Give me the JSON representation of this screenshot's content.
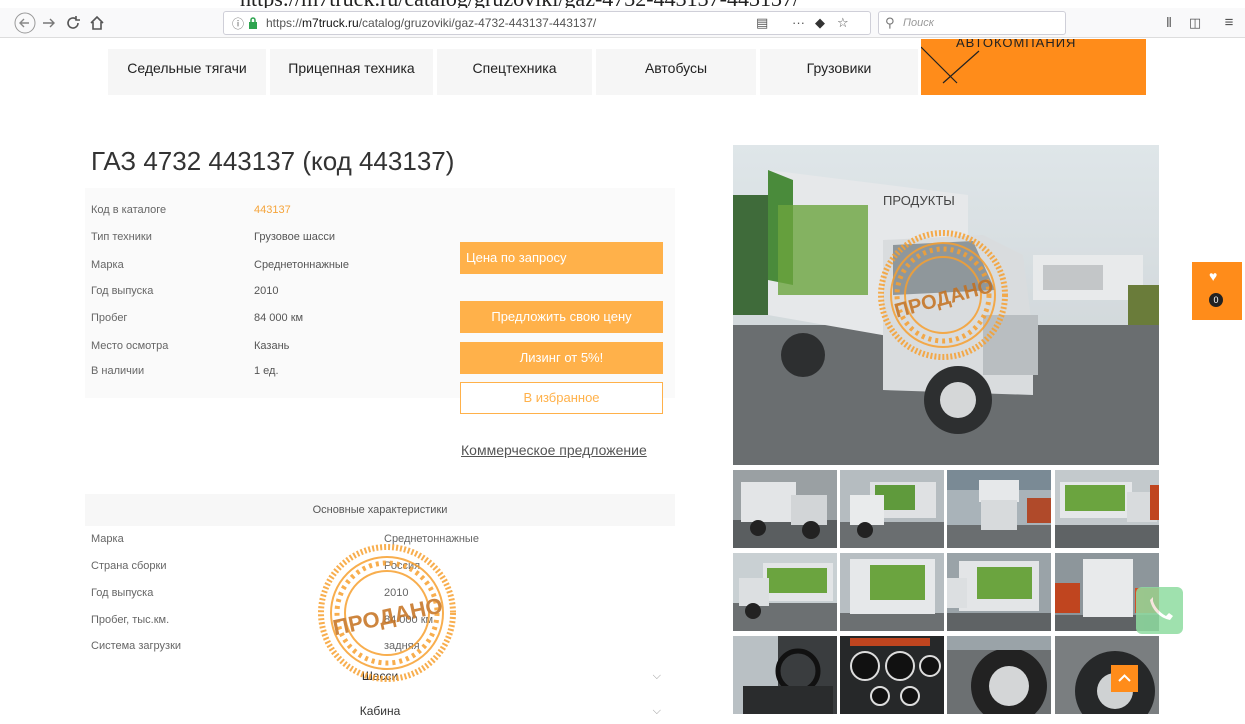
{
  "top_overlay": "https://m7truck.ru/catalog/gruzoviki/gaz-4732-443137-443137/",
  "browser": {
    "url_prefix": "https://",
    "url_domain": "m7truck.ru",
    "url_path": "/catalog/gruzoviki/gaz-4732-443137-443137/",
    "search_placeholder": "Поиск",
    "icons": [
      "back-icon",
      "forward-icon",
      "reload-icon",
      "home-icon",
      "info-icon",
      "lock-icon",
      "reader-icon",
      "more-icon",
      "pocket-icon",
      "bookmark-star-icon",
      "search-icon",
      "library-icon",
      "sidebar-icon",
      "menu-icon"
    ]
  },
  "nav": {
    "items": [
      "Седельные тягачи",
      "Прицепная техника",
      "Спецтехника",
      "Автобусы",
      "Грузовики"
    ],
    "orange_label": "АВТОКОМПАНИЯ",
    "accent": "#ff8c1a"
  },
  "product": {
    "title": "ГАЗ 4732 443137 (код 443137)",
    "specs": [
      {
        "label": "Код в каталоге",
        "value": "443137"
      },
      {
        "label": "Тип техники",
        "value": "Грузовое шасси"
      },
      {
        "label": "Марка",
        "value": "Среднетоннажные"
      },
      {
        "label": "Год выпуска",
        "value": "2010"
      },
      {
        "label": "Пробег",
        "value": "84 000 км"
      },
      {
        "label": "Место осмотра",
        "value": "Казань"
      },
      {
        "label": "В наличии",
        "value": "1 ед."
      }
    ],
    "buttons": {
      "price": "Цена по запросу",
      "offer": "Предложить свою цену",
      "leasing": "Лизинг от 5%!",
      "favorite": "В избранное",
      "commercial": "Коммерческое предложение"
    },
    "button_color": "#ffb14a"
  },
  "characteristics": {
    "header": "Основные характеристики",
    "rows": [
      {
        "label": "Марка",
        "value": "Среднетоннажные"
      },
      {
        "label": "Страна сборки",
        "value": "Россия"
      },
      {
        "label": "Год выпуска",
        "value": "2010"
      },
      {
        "label": "Пробег, тыс.км.",
        "value": "84 000 км"
      },
      {
        "label": "Система загрузки",
        "value": "задняя"
      }
    ],
    "sections": [
      "Шасси",
      "Кабина"
    ]
  },
  "stamp_text": "ПРОДАНО",
  "truck_sign": "ПРОДУКТЫ",
  "favorites_count": "0"
}
